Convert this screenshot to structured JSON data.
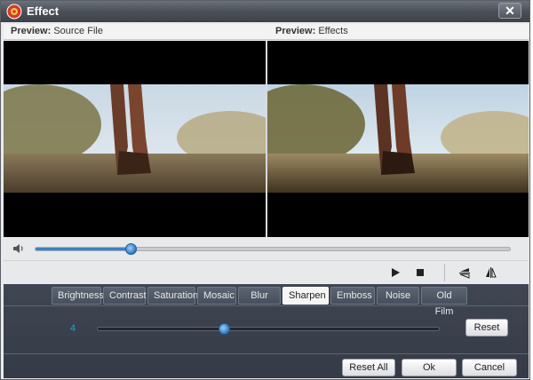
{
  "window": {
    "title": "Effect",
    "close_label": "✕"
  },
  "preview": {
    "left_label": "Preview:",
    "left_value": "Source File",
    "right_label": "Preview:",
    "right_value": "Effects"
  },
  "playback": {
    "seek_progress": 0.2
  },
  "tabs": [
    {
      "label": "Brightness",
      "active": false
    },
    {
      "label": "Contrast",
      "active": false
    },
    {
      "label": "Saturation",
      "active": false
    },
    {
      "label": "Mosaic",
      "active": false
    },
    {
      "label": "Blur",
      "active": false
    },
    {
      "label": "Sharpen",
      "active": true
    },
    {
      "label": "Emboss",
      "active": false
    },
    {
      "label": "Noise",
      "active": false
    },
    {
      "label": "Old Film",
      "active": false
    }
  ],
  "effect": {
    "value": "4",
    "level": 0.37,
    "reset_label": "Reset"
  },
  "footer": {
    "reset_all_label": "Reset All",
    "ok_label": "Ok",
    "cancel_label": "Cancel"
  },
  "colors": {
    "accent": "#2a79c2",
    "panel_bg": "#3f4652",
    "value_text": "#2aa3c8"
  }
}
